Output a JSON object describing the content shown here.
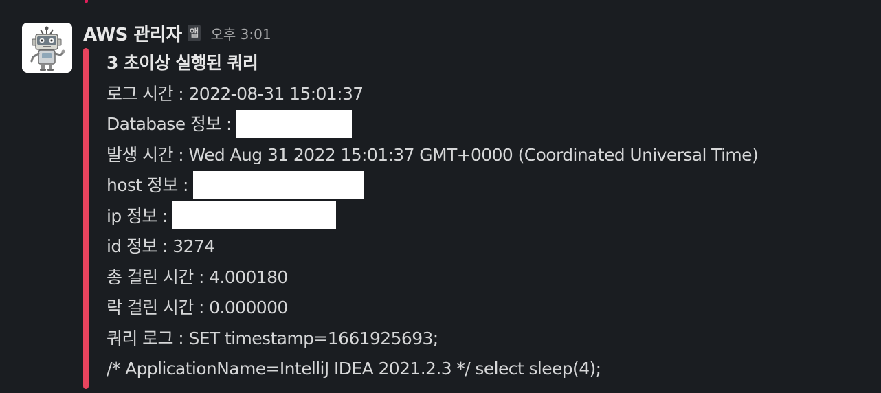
{
  "message": {
    "sender": "AWS 관리자",
    "badge": "앱",
    "time": "오후 3:01",
    "avatar_icon": "robot-icon",
    "accent_color": "#e8445e"
  },
  "body": {
    "title": "3 초이상 실행된 쿼리",
    "lines": {
      "log_time": "로그 시간 : 2022-08-31 15:01:37",
      "database_label": "Database 정보 :",
      "occurred": "발생 시간 : Wed Aug 31 2022 15:01:37 GMT+0000 (Coordinated Universal Time)",
      "host_label": "host 정보 :",
      "ip_label": "ip 정보 :",
      "id": "id 정보 : 3274",
      "total_time": "총 걸린 시간 : 4.000180",
      "lock_time": "락 걸린 시간 : 0.000000",
      "query_log": "쿼리 로그 : SET timestamp=1661925693;",
      "query_sql": "/* ApplicationName=IntelliJ IDEA 2021.2.3 */ select sleep(4);"
    }
  }
}
